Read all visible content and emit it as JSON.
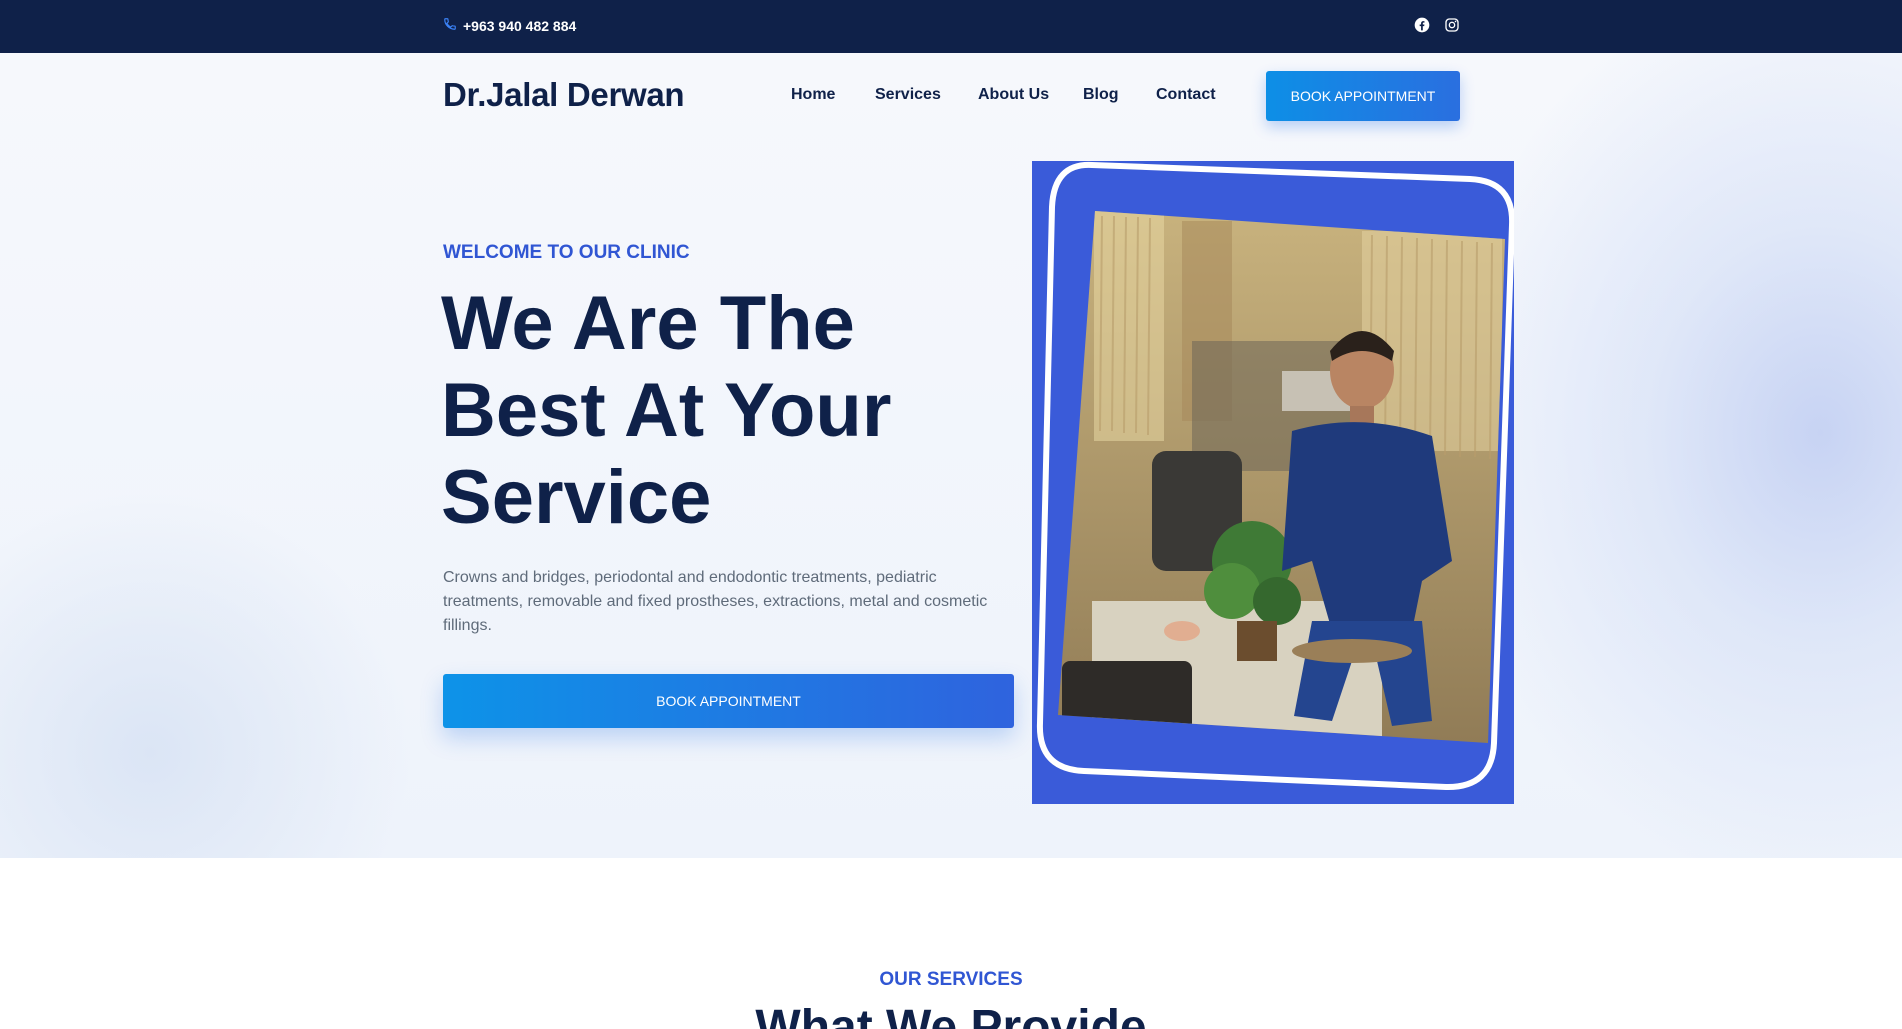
{
  "topbar": {
    "phone": "+963 940 482 884",
    "phone_icon": "phone-icon",
    "social_icons": [
      "facebook-icon",
      "instagram-icon"
    ]
  },
  "header": {
    "logo": "Dr.Jalal Derwan",
    "nav": [
      "Home",
      "Services",
      "About Us",
      "Blog",
      "Contact"
    ],
    "cta": "BOOK APPOINTMENT"
  },
  "hero": {
    "eyebrow": "WELCOME TO OUR CLINIC",
    "headline_lines": [
      "We Are The",
      "Best At Your",
      "Service"
    ],
    "description": "Crowns and bridges, periodontal and endodontic treatments, pediatric treatments, removable and fixed prostheses, extractions, metal and cosmetic fillings.",
    "cta": "BOOK APPOINTMENT",
    "image": "dentist-in-clinic-photo"
  },
  "services": {
    "eyebrow": "OUR SERVICES",
    "title": "What We Provide"
  },
  "colors": {
    "navy": "#0f2149",
    "accent": "#3056d3",
    "button": "#0d8fe6"
  }
}
